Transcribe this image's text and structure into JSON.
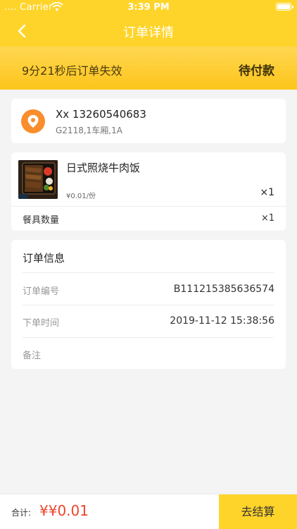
{
  "status_bar": {
    "carrier": ".... Carrier",
    "time": "3:39 PM"
  },
  "nav": {
    "title": "订单详情",
    "back_icon": "chevron-left-icon"
  },
  "banner": {
    "countdown": "9分21秒后订单失效",
    "status": "待付款"
  },
  "address": {
    "icon": "location-pin-icon",
    "name_phone": "Xx 13260540683",
    "detail": "G2118,1车厢,1A"
  },
  "food": {
    "name": "日式照烧牛肉饭",
    "price": "¥0.01/份",
    "quantity": "×1",
    "utensil_label": "餐具数量",
    "utensil_quantity": "×1"
  },
  "order_info": {
    "title": "订单信息",
    "rows": [
      {
        "label": "订单编号",
        "value": "B111215385636574"
      },
      {
        "label": "下单时间",
        "value": "2019-11-12 15:38:56"
      },
      {
        "label": "备注",
        "value": ""
      }
    ]
  },
  "bottom": {
    "total_label": "合计:",
    "total_value": "¥¥0.01",
    "checkout_label": "去结算"
  },
  "colors": {
    "accent": "#ffd42a",
    "price_red": "#f0432b",
    "pin_orange": "#fa8d2c"
  }
}
